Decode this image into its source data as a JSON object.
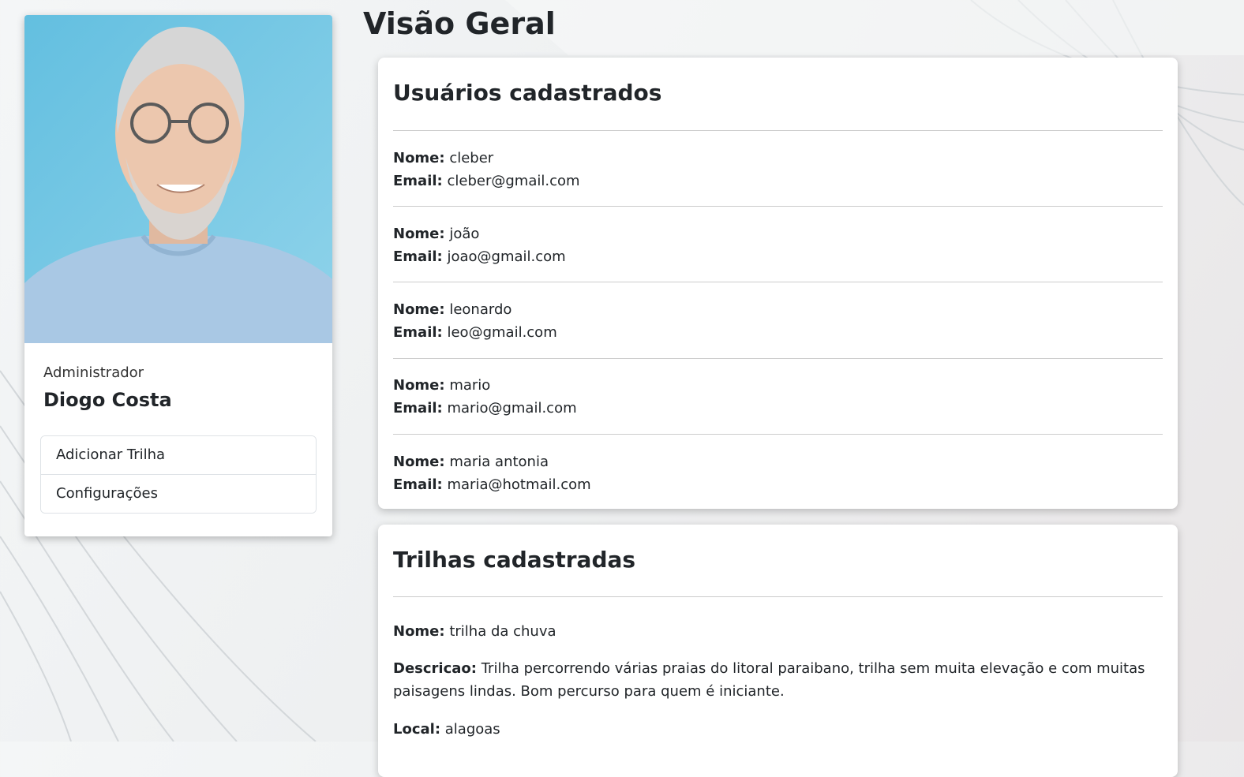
{
  "profile": {
    "role": "Administrador",
    "name": "Diogo Costa",
    "menu": [
      {
        "label": "Adicionar Trilha"
      },
      {
        "label": "Configurações"
      }
    ]
  },
  "page": {
    "title": "Visão Geral"
  },
  "users_panel": {
    "title": "Usuários cadastrados",
    "name_label": "Nome:",
    "email_label": "Email:",
    "users": [
      {
        "name": "cleber",
        "email": "cleber@gmail.com"
      },
      {
        "name": "joão",
        "email": "joao@gmail.com"
      },
      {
        "name": "leonardo",
        "email": "leo@gmail.com"
      },
      {
        "name": "mario",
        "email": "mario@gmail.com"
      },
      {
        "name": "maria antonia",
        "email": "maria@hotmail.com"
      }
    ]
  },
  "trails_panel": {
    "title": "Trilhas cadastradas",
    "trails": [
      {
        "name_label": "Nome:",
        "name": "trilha da chuva",
        "description_label": "Descricao:",
        "description": "Trilha percorrendo várias praias do litoral paraibano, trilha sem muita elevação e com muitas paisagens lindas. Bom percurso para quem é iniciante.",
        "location_label": "Local:",
        "location": "alagoas"
      }
    ]
  }
}
